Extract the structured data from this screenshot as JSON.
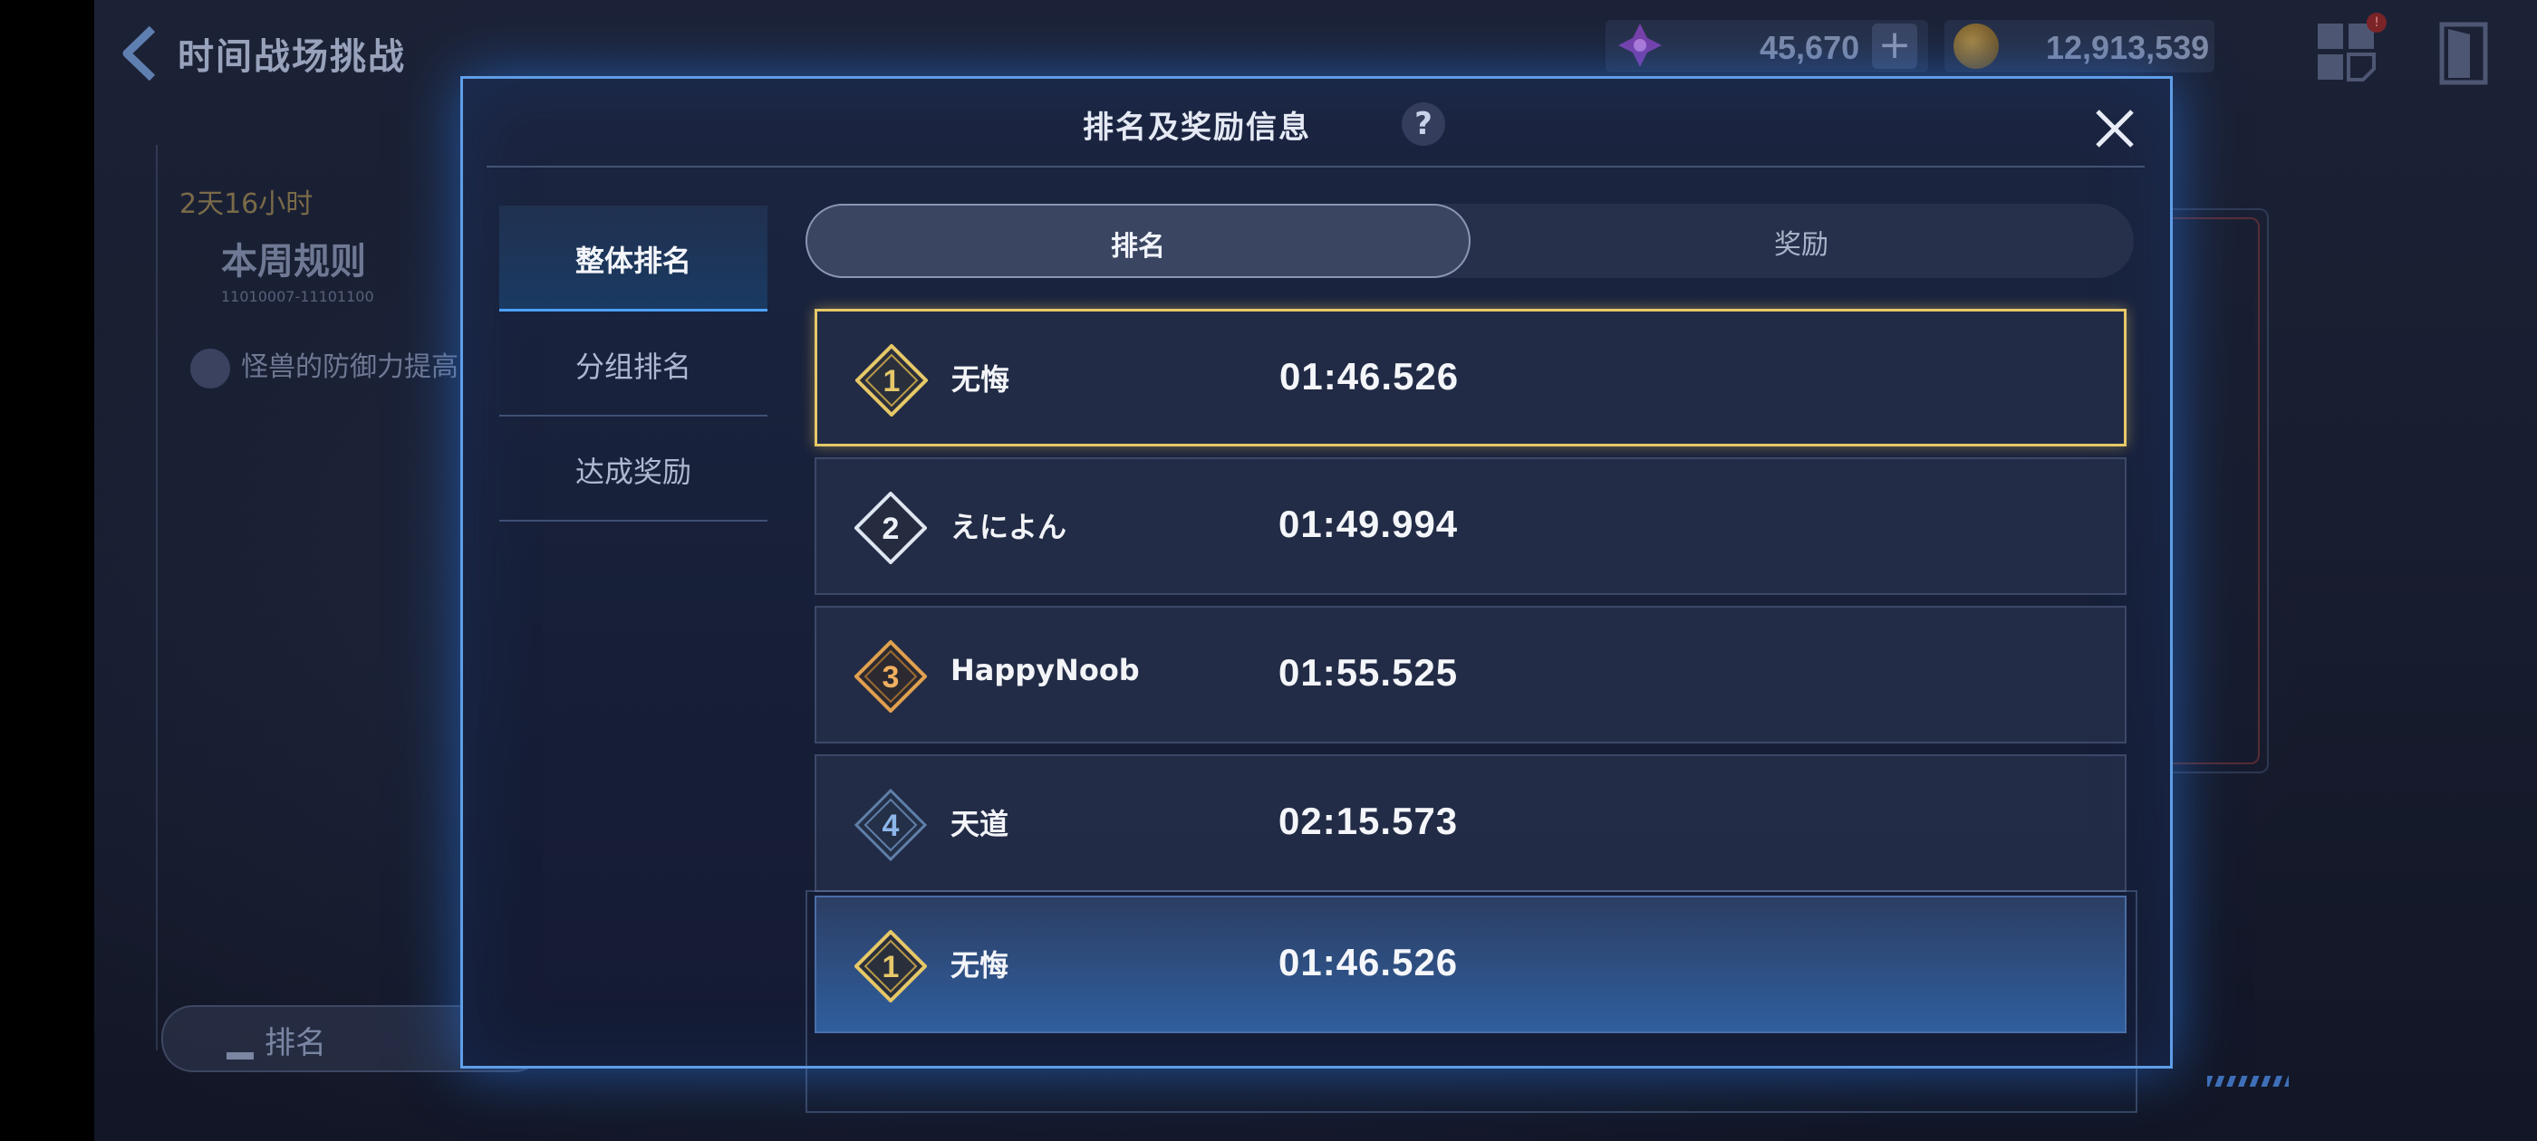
{
  "topbar": {
    "title": "时间战场挑战",
    "gems": "45,670",
    "plus": "+",
    "coins": "12,913,539",
    "notification_badge": "!"
  },
  "background": {
    "time_left": "2天16小时",
    "weekly_rule": "本周规则",
    "rule_sub": "11010007-11101100",
    "monster_line": "怪兽的防御力提高",
    "rank_button": "排名"
  },
  "modal": {
    "title": "排名及奖励信息",
    "help": "?",
    "side_menu": [
      {
        "label": "整体排名",
        "active": true
      },
      {
        "label": "分组排名",
        "active": false
      },
      {
        "label": "达成奖励",
        "active": false
      }
    ],
    "tabs": {
      "ranking": "排名",
      "rewards": "奖励"
    },
    "rows": [
      {
        "rank": "1",
        "name": "无悔",
        "time": "01:46.526"
      },
      {
        "rank": "2",
        "name": "えによん",
        "time": "01:49.994"
      },
      {
        "rank": "3",
        "name": "HappyNoob",
        "time": "01:55.525"
      },
      {
        "rank": "4",
        "name": "天道",
        "time": "02:15.573"
      }
    ],
    "my_row": {
      "rank": "1",
      "name": "无悔",
      "time": "01:46.526"
    }
  },
  "colors": {
    "gold": "#e6c868",
    "silver": "#dfe6f2",
    "bronze": "#e0a050",
    "blue_rank": "#8db6ea",
    "modal_border": "#5f9ee8"
  }
}
